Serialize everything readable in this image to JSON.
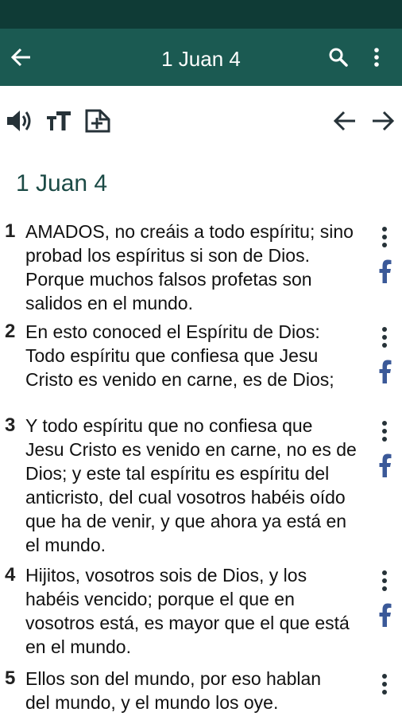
{
  "app_bar": {
    "title": "1 Juan 4"
  },
  "colors": {
    "status_bar": "#0f3b36",
    "app_bar": "#1b5a52",
    "facebook": "#3b5998",
    "heading": "#1b4a45"
  },
  "toolbar": {
    "icons": [
      "speaker-icon",
      "text-size-icon",
      "add-note-icon",
      "arrow-left-icon",
      "arrow-right-icon"
    ]
  },
  "chapter": {
    "heading": "1 Juan 4"
  },
  "verses": [
    {
      "number": "1",
      "text": "AMADOS, no creáis a todo espíritu; sino\nprobad los espíritus si son de Dios.\nPorque muchos falsos profetas son\nsalidos en el mundo."
    },
    {
      "number": "2",
      "text": "En esto conoced el Espíritu de Dios:\nTodo espíritu que confiesa que Jesu\nCristo es venido en carne, es de Dios;"
    },
    {
      "number": "3",
      "text": "Y todo espíritu que no confiesa que\nJesu Cristo es venido en carne, no es de\nDios; y este tal espíritu es espíritu del\nanticristo, del cual vosotros habéis oído\nque ha de venir, y que ahora ya está en\nel mundo."
    },
    {
      "number": "4",
      "text": "Hijitos, vosotros sois de Dios, y los\nhabéis vencido; porque el que en\nvosotros está, es mayor que el que está\nen el mundo."
    },
    {
      "number": "5",
      "text": "Ellos son del mundo, por eso hablan\ndel mundo, y el mundo los oye."
    }
  ]
}
